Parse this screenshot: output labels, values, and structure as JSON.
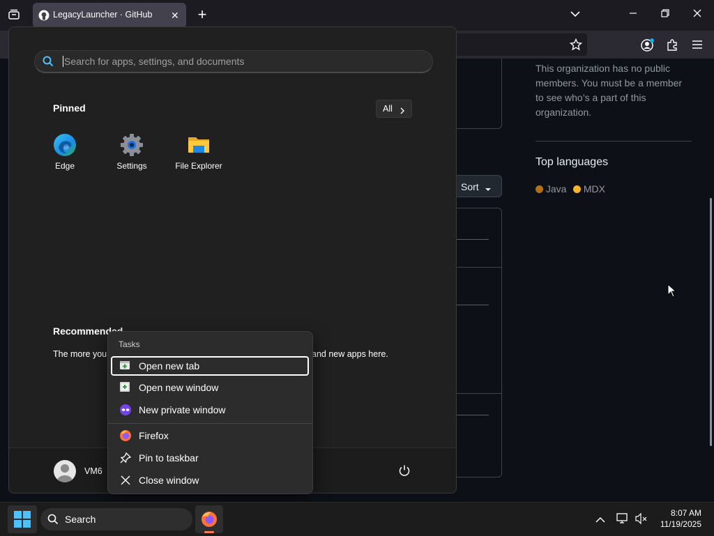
{
  "browser": {
    "tab_title": "LegacyLauncher · GitHub",
    "new_tab_symbol": "+"
  },
  "github": {
    "members_text": "This organization has no public members. You must be a member to see who’s a part of this organization.",
    "top_languages_heading": "Top languages",
    "languages": [
      {
        "name": "Java",
        "color": "#b07219"
      },
      {
        "name": "MDX",
        "color": "#fcb32c"
      }
    ],
    "sort_label": "Sort"
  },
  "start_menu": {
    "search_placeholder": "Search for apps, settings, and documents",
    "pinned_heading": "Pinned",
    "all_button": "All",
    "pinned_apps": [
      {
        "label": "Edge",
        "icon": "edge-icon"
      },
      {
        "label": "Settings",
        "icon": "settings-gear-icon"
      },
      {
        "label": "File Explorer",
        "icon": "folder-icon"
      }
    ],
    "recommended_heading": "Recommended",
    "recommended_text_left": "The more you",
    "recommended_text_right": "and new apps here.",
    "user_name": "VM6"
  },
  "context_menu": {
    "section_label": "Tasks",
    "items": [
      {
        "label": "Open new tab",
        "icon": "new-tab-icon"
      },
      {
        "label": "Open new window",
        "icon": "new-window-icon"
      },
      {
        "label": "New private window",
        "icon": "private-mask-icon"
      },
      {
        "label": "Firefox",
        "icon": "firefox-icon"
      },
      {
        "label": "Pin to taskbar",
        "icon": "pin-icon"
      },
      {
        "label": "Close window",
        "icon": "close-icon"
      }
    ]
  },
  "taskbar": {
    "search_label": "Search",
    "time": "8:07 AM",
    "date": "11/19/2025"
  }
}
